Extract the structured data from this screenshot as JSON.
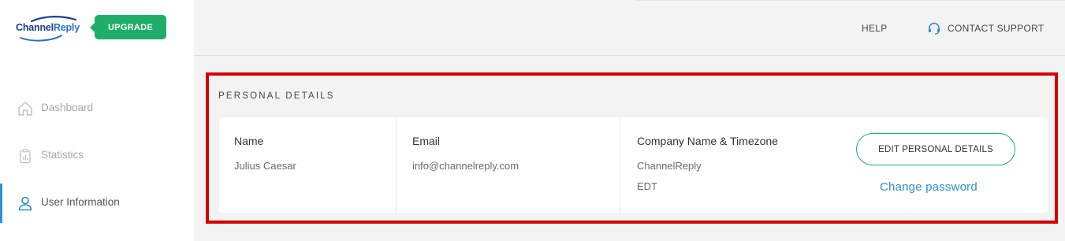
{
  "brand": {
    "logo_text_part1": "Channel",
    "logo_text_part2": "Reply",
    "upgrade_label": "UPGRADE",
    "accent_green": "#1fae6a",
    "accent_blue": "#2d8fd5"
  },
  "sidebar": {
    "items": [
      {
        "label": "Dashboard",
        "icon": "home-icon",
        "active": false
      },
      {
        "label": "Statistics",
        "icon": "clipboard-chart-icon",
        "active": false
      },
      {
        "label": "User Information",
        "icon": "user-icon",
        "active": true
      }
    ]
  },
  "header": {
    "help_label": "HELP",
    "support_label": "CONTACT SUPPORT",
    "support_icon": "headset-icon"
  },
  "personal_details": {
    "section_title": "PERSONAL DETAILS",
    "name_label": "Name",
    "name_value": "Julius Caesar",
    "email_label": "Email",
    "email_value": "info@channelreply.com",
    "company_label": "Company Name & Timezone",
    "company_value": "ChannelReply",
    "timezone_value": "EDT",
    "edit_button_label": "EDIT PERSONAL DETAILS",
    "change_password_label": "Change password"
  }
}
